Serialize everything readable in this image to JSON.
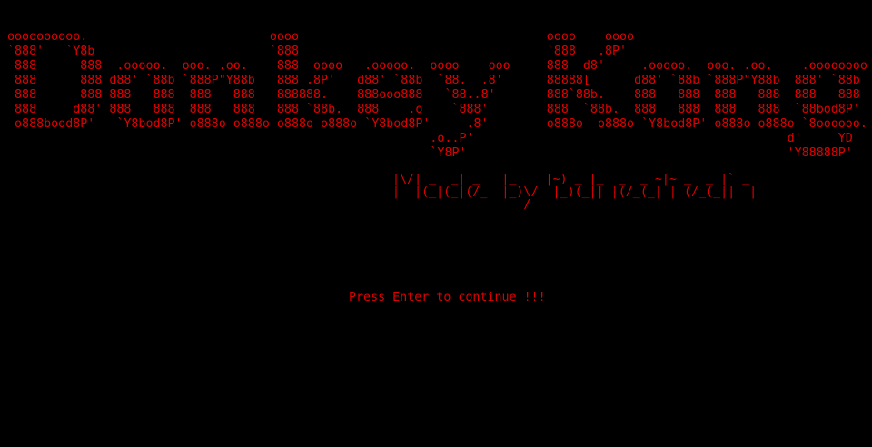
{
  "theme": {
    "background": "#000000",
    "text_color": "#e00000"
  },
  "banner": {
    "title_art": "oooooooooo.                         oooo                                  oooo    oooo\n`888'   `Y8b                        `888                                  `888   .8P'\n 888      888  .ooooo.  ooo. .oo.    888  oooo   .ooooo.  oooo    ooo     888  d8'     .ooooo.  ooo. .oo.    .oooooooo\n 888      888 d88' `88b `888P\"Y88b   888 .8P'   d88' `88b  `88.  .8'      88888[      d88' `88b `888P\"Y88b  888' `88b\n 888      888 888   888  888   888   888888.    888ooo888   `88..8'       888`88b.    888   888  888   888  888   888\n 888     d88' 888   888  888   888   888 `88b.  888    .o    `888'        888  `88b.  888   888  888   888  `88bod8P'\n o888bood8P'   `Y8bod8P' o888o o888o o888o o888o `Y8bod8P'     .8'        o888o  o888o `Y8bod8P' o888o o888o `8oooooo.\n                                                          .o..P'                                           d'     YD\n                                                          `Y8P'                                            'Y88888P'"
  },
  "credit": {
    "art": "|\\/| _  _| _   |_    |~) _ |_  _  _ ~|~ _  _ |` _\n|  |(_|(_|(/_  |_)\\/  |_)(_|| |(/_(_| | (/_(_||  |\n                  /"
  },
  "prompt": {
    "text": "Press Enter to continue !!!"
  }
}
